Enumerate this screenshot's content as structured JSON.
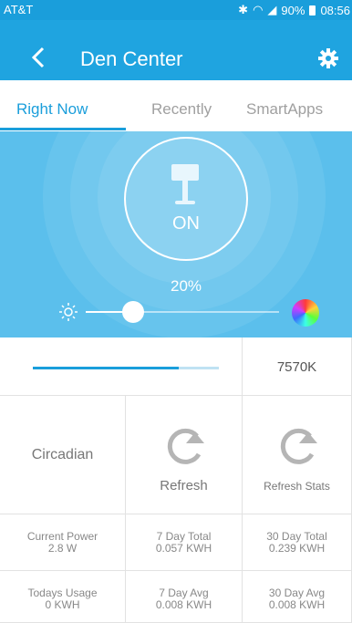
{
  "status": {
    "carrier": "AT&T",
    "battery": "90%",
    "time": "08:56"
  },
  "header": {
    "title": "Den Center"
  },
  "tabs": [
    "Right Now",
    "Recently",
    "SmartApps"
  ],
  "device": {
    "state": "ON",
    "level_pct": "20%",
    "level": 0.2,
    "color_temp": "7570K",
    "temp_level": 0.78
  },
  "actions": {
    "circadian": "Circadian",
    "refresh": "Refresh",
    "refresh_stats": "Refresh Stats"
  },
  "stats": [
    {
      "label": "Current Power",
      "value": "2.8 W"
    },
    {
      "label": "7 Day Total",
      "value": "0.057 KWH"
    },
    {
      "label": "30 Day Total",
      "value": "0.239 KWH"
    },
    {
      "label": "Todays Usage",
      "value": "0 KWH"
    },
    {
      "label": "7 Day Avg",
      "value": "0.008 KWH"
    },
    {
      "label": "30 Day Avg",
      "value": "0.008 KWH"
    }
  ],
  "colors": {
    "accent": "#1a9edb",
    "hero": "#5bbfec"
  }
}
